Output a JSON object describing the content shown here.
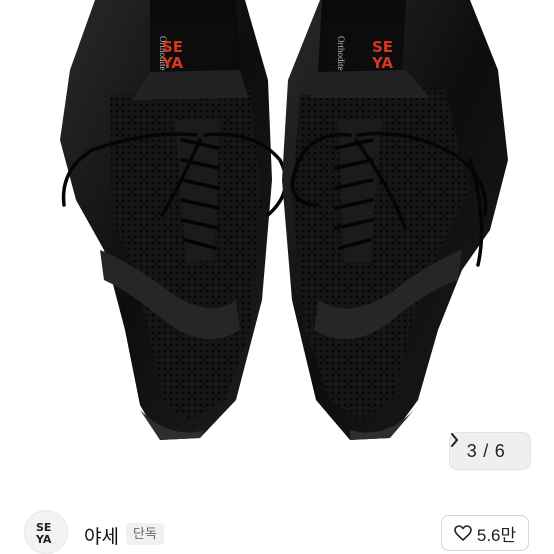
{
  "gallery": {
    "counter": {
      "current": "3",
      "separator": "/",
      "total": "6"
    },
    "brand_mark_text": "Orthodite",
    "brand_logo_text": "SE\nYA"
  },
  "shop": {
    "name": "야세",
    "badge": "단독",
    "logo_text": "SE YA"
  },
  "like": {
    "count": "5.6만"
  },
  "colors": {
    "logo_red": "#d8361e",
    "shoe_black": "#111111",
    "background": "#ffffff"
  },
  "icons": {
    "next": "chevron-right-icon",
    "like": "heart-outline-icon"
  }
}
